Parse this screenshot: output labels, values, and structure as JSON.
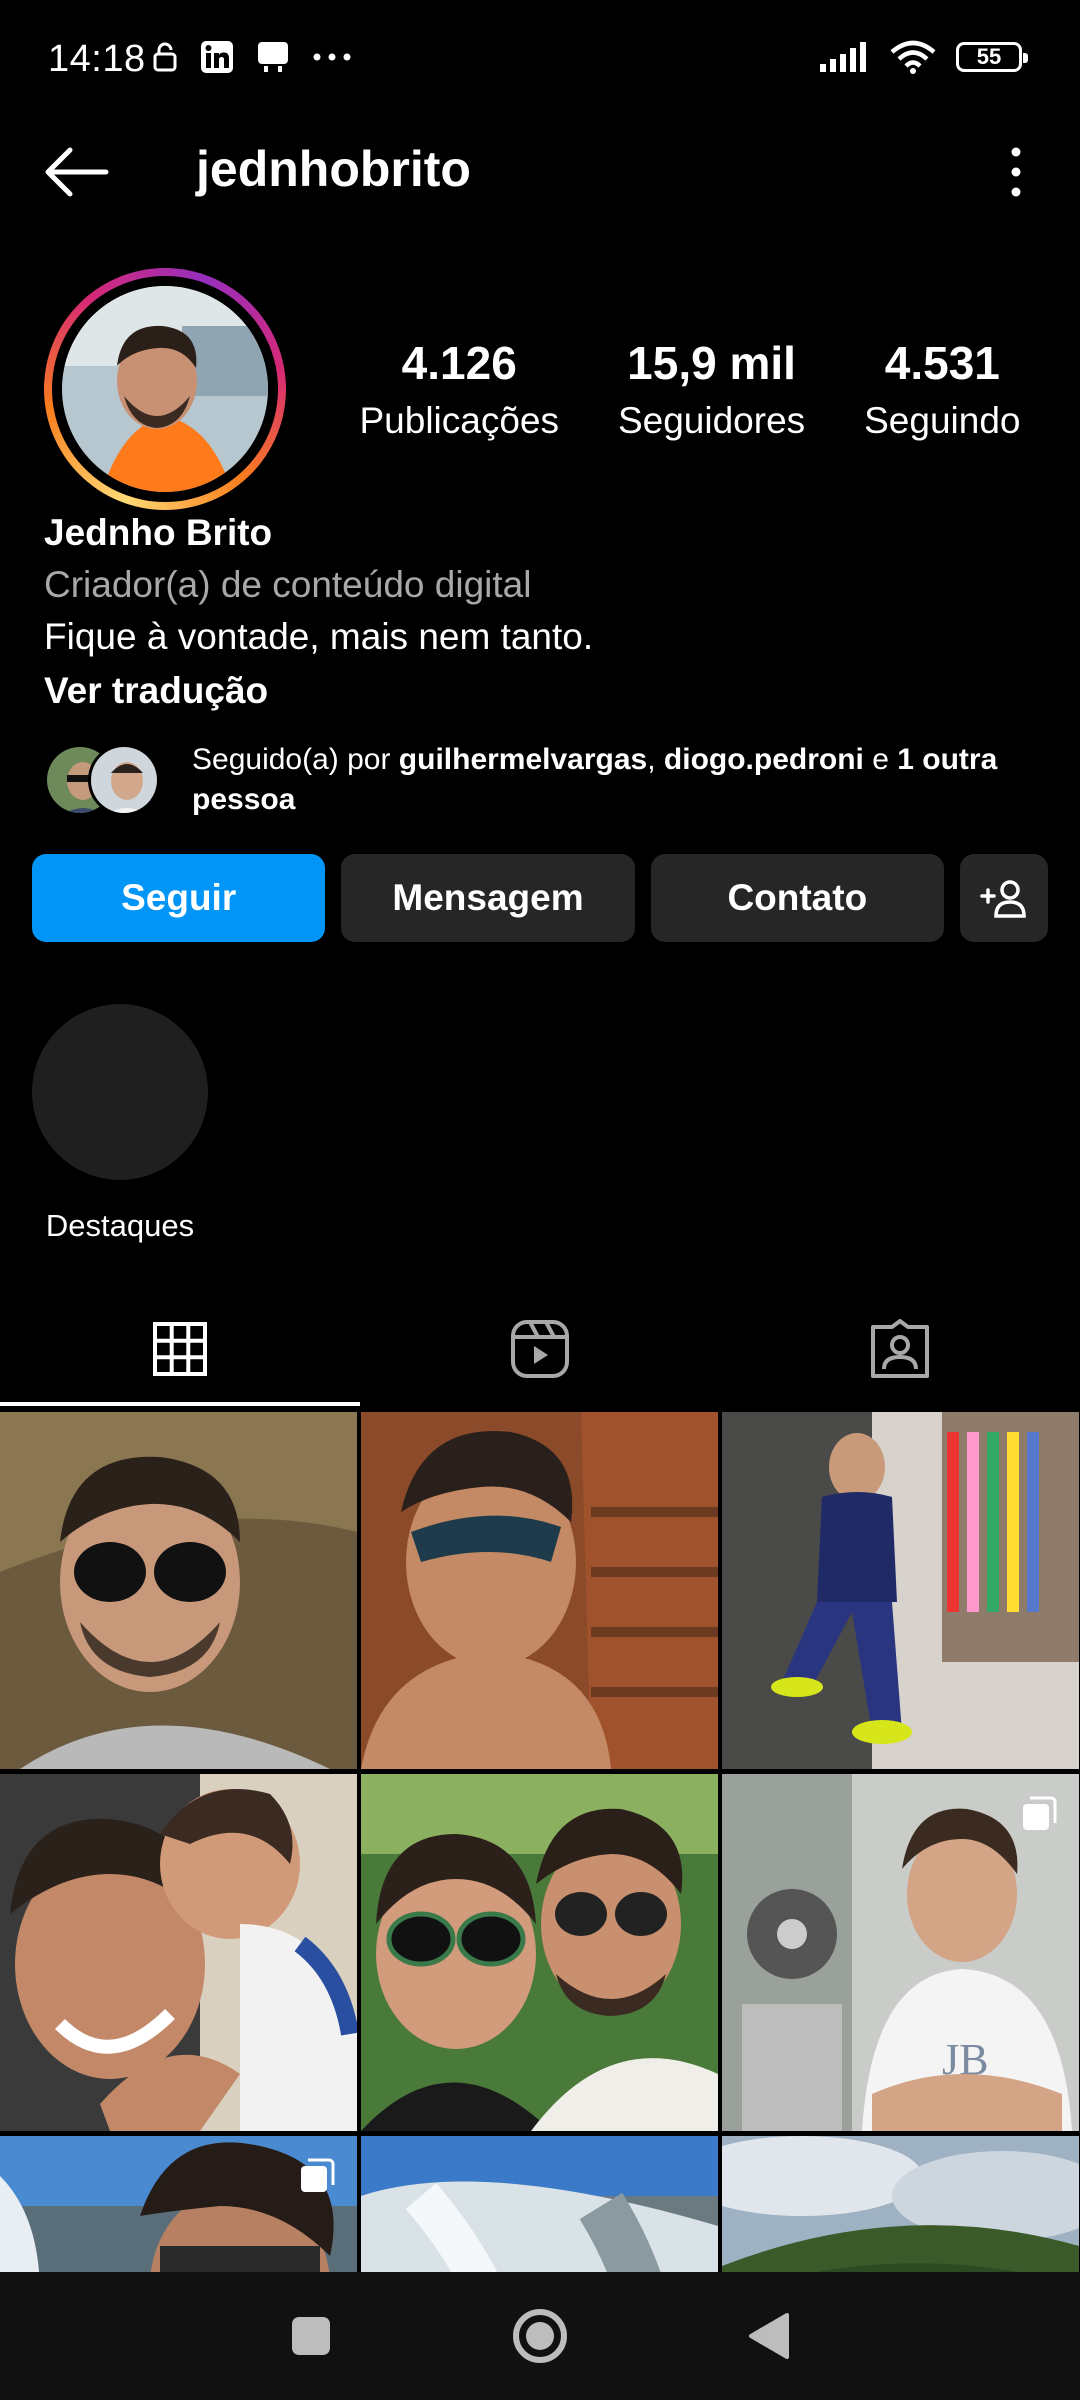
{
  "status_bar": {
    "time": "14:18",
    "battery": "55",
    "icons": [
      "lock-icon",
      "linkedin-icon",
      "notification-icon",
      "more-dots-icon",
      "signal-icon",
      "wifi-icon",
      "battery-icon"
    ]
  },
  "header": {
    "username": "jednhobrito"
  },
  "profile": {
    "full_name": "Jednho Brito",
    "category": "Criador(a) de conteúdo digital",
    "bio": "Fique à vontade, mais nem tanto.",
    "translate": "Ver tradução",
    "stats": [
      {
        "value": "4.126",
        "label": "Publicações"
      },
      {
        "value": "15,9 mil",
        "label": "Seguidores"
      },
      {
        "value": "4.531",
        "label": "Seguindo"
      }
    ],
    "followed_by": {
      "prefix": "Seguido(a) por ",
      "user1": "guilhermelvargas",
      "sep": ", ",
      "user2": "diogo.pedroni",
      "conj": " e ",
      "rest": "1 outra pessoa"
    }
  },
  "actions": {
    "follow": "Seguir",
    "message": "Mensagem",
    "contact": "Contato"
  },
  "highlights": [
    {
      "label": "Destaques"
    }
  ],
  "colors": {
    "accent": "#0095f6",
    "button_bg": "#262626"
  }
}
